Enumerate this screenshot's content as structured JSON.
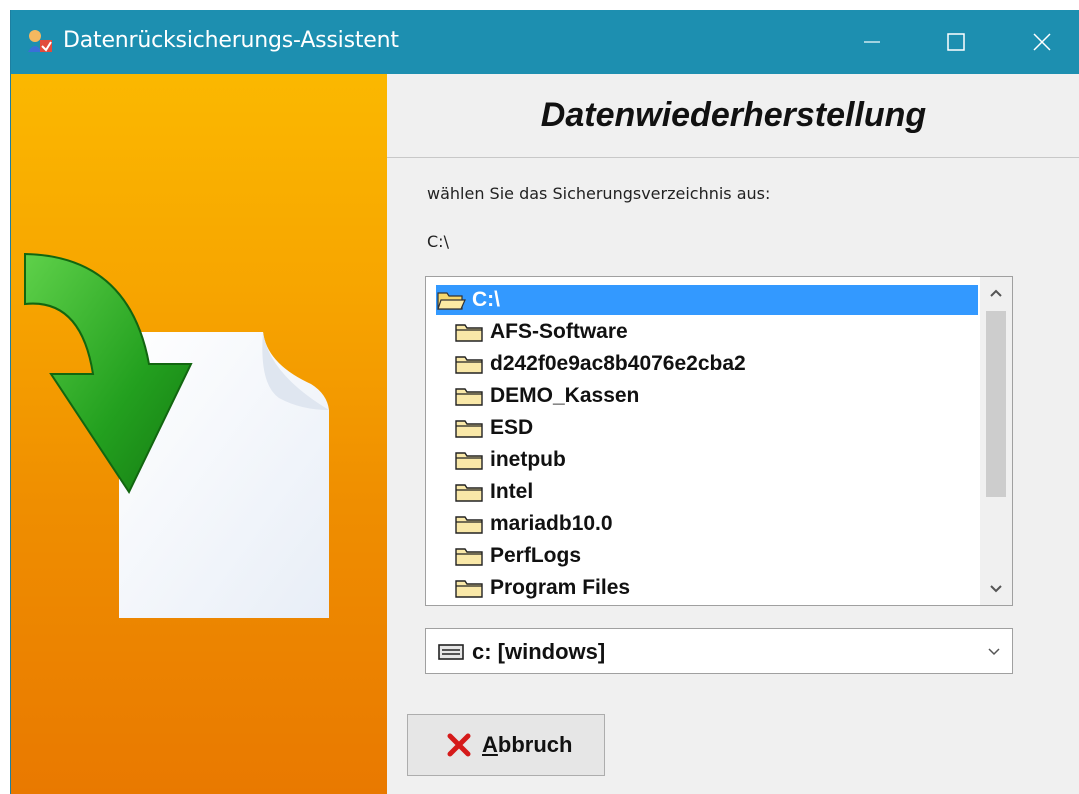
{
  "window": {
    "title": "Datenrücksicherungs-Assistent",
    "accent_color": "#1d8fb0"
  },
  "header": {
    "title": "Datenwiederherstellung"
  },
  "prompt": "wählen Sie das Sicherungsverzeichnis aus:",
  "current_path": "C:\\",
  "directory_list": {
    "root": "C:\\",
    "items": [
      "AFS-Software",
      "d242f0e9ac8b4076e2cba2",
      "DEMO_Kassen",
      "ESD",
      "inetpub",
      "Intel",
      "mariadb10.0",
      "PerfLogs",
      "Program Files"
    ],
    "selected_color": "#3399ff"
  },
  "drive": {
    "selected": "c: [windows]"
  },
  "cancel_button": {
    "mnemonic": "A",
    "rest": "bbruch"
  },
  "icons": {
    "app": "restore-wizard-icon",
    "minimize": "minimize-icon",
    "maximize": "maximize-icon",
    "close": "close-icon",
    "folder": "folder-icon",
    "open_folder": "open-folder-icon",
    "drive": "drive-icon",
    "cancel": "red-x-icon"
  }
}
